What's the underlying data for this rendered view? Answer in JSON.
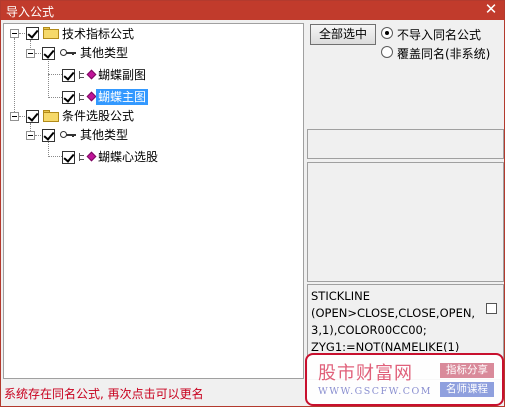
{
  "window": {
    "title": "导入公式",
    "close_glyph": "✕"
  },
  "tree": {
    "items": [
      {
        "label": "技术指标公式",
        "level": 0,
        "icon": "folder-icon",
        "checked": true,
        "expanded": true
      },
      {
        "label": "其他类型",
        "level": 1,
        "icon": "key-icon",
        "checked": true,
        "expanded": true
      },
      {
        "label": "蝴蝶副图",
        "level": 2,
        "icon": "formula-diamond-icon",
        "checked": true
      },
      {
        "label": "蝴蝶主图",
        "level": 2,
        "icon": "formula-diamond-icon",
        "checked": true,
        "selected": true
      },
      {
        "label": "条件选股公式",
        "level": 0,
        "icon": "folder-icon",
        "checked": true,
        "expanded": true
      },
      {
        "label": "其他类型",
        "level": 1,
        "icon": "key-icon",
        "checked": true,
        "expanded": true
      },
      {
        "label": "蝴蝶心选股",
        "level": 2,
        "icon": "formula-diamond-icon",
        "checked": true
      }
    ]
  },
  "options": {
    "select_all_label": "全部选中",
    "radio_skip_label": "不导入同名公式",
    "radio_overwrite_label": "覆盖同名(非系统)",
    "selected_radio": "radio_skip_label"
  },
  "code_preview": "STICKLINE\n(OPEN>CLOSE,CLOSE,OPEN,\n3,1),COLOR00CC00;\nZYG1:=NOT(NAMELIKE(1)",
  "status_text": "系统存在同名公式, 再次点击可以更名",
  "watermark": {
    "brand": "股市财富网",
    "url": "WWW.GSCFW.COM",
    "badge_one": "指标分享",
    "badge_two": "名师课程"
  },
  "colors": {
    "titlebar": "#c13b2c",
    "selection": "#3399ff",
    "status": "#c8001e"
  }
}
